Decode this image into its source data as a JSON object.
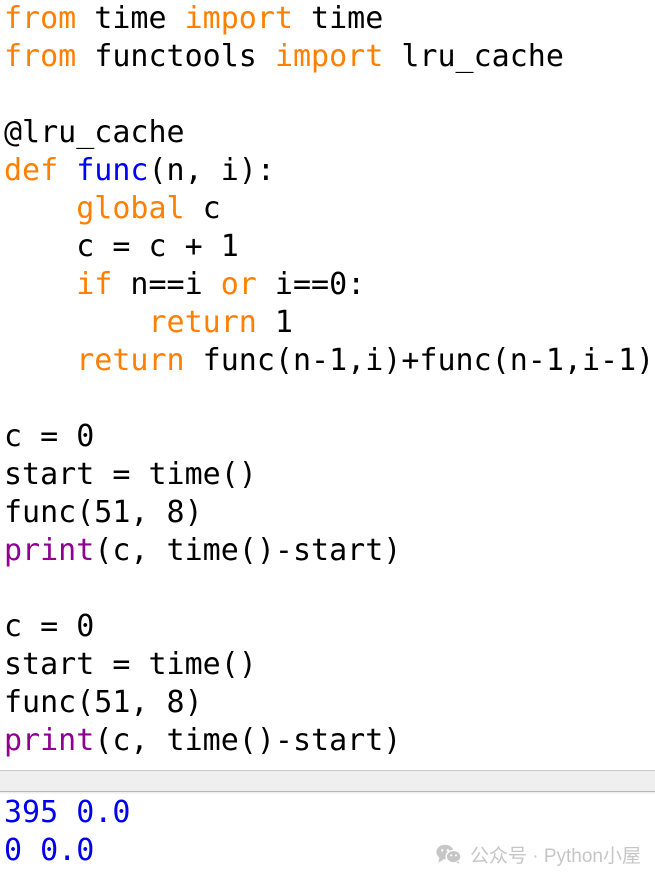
{
  "editor": {
    "language": "python",
    "background": "#ffffff",
    "colors": {
      "keyword": "#ff8000",
      "plain": "#000000",
      "definition": "#0000ff",
      "builtin": "#900090",
      "output": "#0000ee",
      "splitter": "#efefef",
      "watermark": "#c6c6c6"
    },
    "lines": [
      [
        {
          "text": "from",
          "cls": "t-kw"
        },
        {
          "text": " time ",
          "cls": "t-plain"
        },
        {
          "text": "import",
          "cls": "t-kw"
        },
        {
          "text": " time",
          "cls": "t-plain"
        }
      ],
      [
        {
          "text": "from",
          "cls": "t-kw"
        },
        {
          "text": " functools ",
          "cls": "t-plain"
        },
        {
          "text": "import",
          "cls": "t-kw"
        },
        {
          "text": " lru_cache",
          "cls": "t-plain"
        }
      ],
      [
        {
          "text": "",
          "cls": "t-plain"
        }
      ],
      [
        {
          "text": "@lru_cache",
          "cls": "t-plain"
        }
      ],
      [
        {
          "text": "def",
          "cls": "t-kw"
        },
        {
          "text": " ",
          "cls": "t-plain"
        },
        {
          "text": "func",
          "cls": "t-def"
        },
        {
          "text": "(n, i):",
          "cls": "t-plain"
        }
      ],
      [
        {
          "text": "    ",
          "cls": "t-plain"
        },
        {
          "text": "global",
          "cls": "t-kw"
        },
        {
          "text": " c",
          "cls": "t-plain"
        }
      ],
      [
        {
          "text": "    c = c + 1",
          "cls": "t-plain"
        }
      ],
      [
        {
          "text": "    ",
          "cls": "t-plain"
        },
        {
          "text": "if",
          "cls": "t-kw"
        },
        {
          "text": " n==i ",
          "cls": "t-plain"
        },
        {
          "text": "or",
          "cls": "t-kw"
        },
        {
          "text": " i==0:",
          "cls": "t-plain"
        }
      ],
      [
        {
          "text": "        ",
          "cls": "t-plain"
        },
        {
          "text": "return",
          "cls": "t-kw"
        },
        {
          "text": " 1",
          "cls": "t-plain"
        }
      ],
      [
        {
          "text": "    ",
          "cls": "t-plain"
        },
        {
          "text": "return",
          "cls": "t-kw"
        },
        {
          "text": " func(n-1,i)+func(n-1,i-1)",
          "cls": "t-plain"
        }
      ],
      [
        {
          "text": "",
          "cls": "t-plain"
        }
      ],
      [
        {
          "text": "c = 0",
          "cls": "t-plain"
        }
      ],
      [
        {
          "text": "start = time()",
          "cls": "t-plain"
        }
      ],
      [
        {
          "text": "func(51, 8)",
          "cls": "t-plain"
        }
      ],
      [
        {
          "text": "print",
          "cls": "t-builtin"
        },
        {
          "text": "(c, time()-start)",
          "cls": "t-plain"
        }
      ],
      [
        {
          "text": "",
          "cls": "t-plain"
        }
      ],
      [
        {
          "text": "c = 0",
          "cls": "t-plain"
        }
      ],
      [
        {
          "text": "start = time()",
          "cls": "t-plain"
        }
      ],
      [
        {
          "text": "func(51, 8)",
          "cls": "t-plain"
        }
      ],
      [
        {
          "text": "print",
          "cls": "t-builtin"
        },
        {
          "text": "(c, time()-start)",
          "cls": "t-plain"
        }
      ]
    ]
  },
  "output": {
    "lines": [
      "395 0.0",
      "0 0.0"
    ]
  },
  "watermark": {
    "icon": "wechat-icon",
    "text": "公众号 · Python小屋"
  }
}
